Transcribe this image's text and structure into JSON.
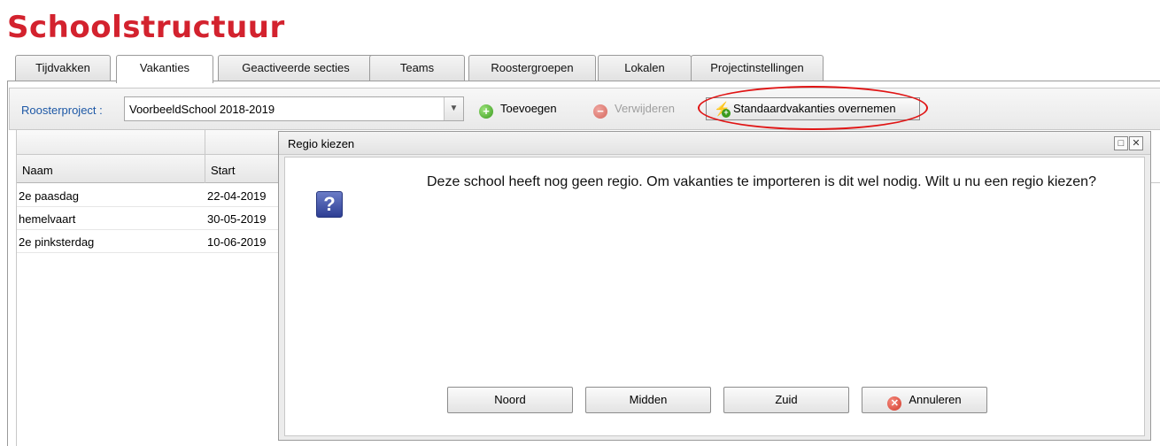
{
  "page": {
    "title": "Schoolstructuur"
  },
  "tabs": [
    {
      "label": "Tijdvakken"
    },
    {
      "label": "Vakanties"
    },
    {
      "label": "Geactiveerde secties"
    },
    {
      "label": "Teams"
    },
    {
      "label": "Roostergroepen"
    },
    {
      "label": "Lokalen"
    },
    {
      "label": "Projectinstellingen"
    }
  ],
  "active_tab": "Vakanties",
  "toolbar": {
    "roosterproject_label": "Roosterproject :",
    "roosterproject_value": "VoorbeeldSchool 2018-2019",
    "add_label": "Toevoegen",
    "remove_label": "Verwijderen",
    "standard_label": "Standaardvakanties overnemen"
  },
  "grid": {
    "columns": [
      "Naam",
      "Start"
    ],
    "rows": [
      {
        "naam": "2e paasdag",
        "start": "22-04-2019"
      },
      {
        "naam": "hemelvaart",
        "start": "30-05-2019"
      },
      {
        "naam": "2e pinksterdag",
        "start": "10-06-2019"
      }
    ]
  },
  "dialog": {
    "title": "Regio kiezen",
    "message": "Deze school heeft nog geen regio. Om vakanties te importeren is dit wel nodig. Wilt u nu een regio kiezen?",
    "buttons": {
      "noord": "Noord",
      "midden": "Midden",
      "zuid": "Zuid",
      "annuleren": "Annuleren"
    }
  },
  "colors": {
    "title_red": "#d3222e",
    "link_blue": "#1d58a6",
    "highlight_red": "#e01515"
  },
  "icons": {
    "add": "plus-circle-icon",
    "remove": "minus-circle-icon",
    "standard": "lightning-add-icon",
    "question": "question-icon",
    "cancel": "cancel-icon"
  }
}
